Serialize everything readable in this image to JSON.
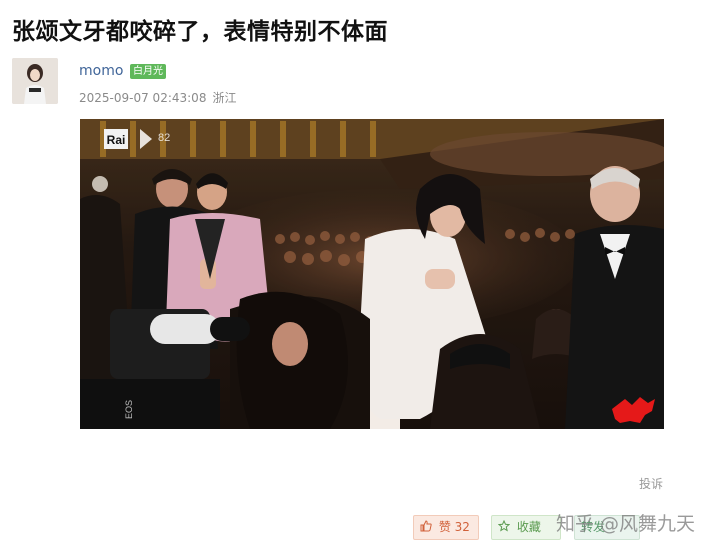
{
  "post": {
    "title": "张颂文牙都咬碎了，表情特别不体面",
    "author": {
      "name": "momo",
      "badge": "白月光",
      "avatar_icon": "avatar-photo"
    },
    "timestamp": "2025-09-07 02:43:08",
    "location": "浙江"
  },
  "media": {
    "overlay": {
      "channel_logo": "Rai",
      "festival_logo_text": "82",
      "camera_brand_text": "EOS",
      "lion_icon": "venice-lion-icon"
    }
  },
  "footer": {
    "report_label": "投诉",
    "like_label": "赞 32",
    "favorite_label": "收藏",
    "share_label": "转发"
  },
  "watermark": "知乎 @风舞九天",
  "colors": {
    "author_link": "#406599",
    "badge_bg": "#5fb85a",
    "like_accent": "#d1613a",
    "favorite_accent": "#5a9a4f"
  }
}
